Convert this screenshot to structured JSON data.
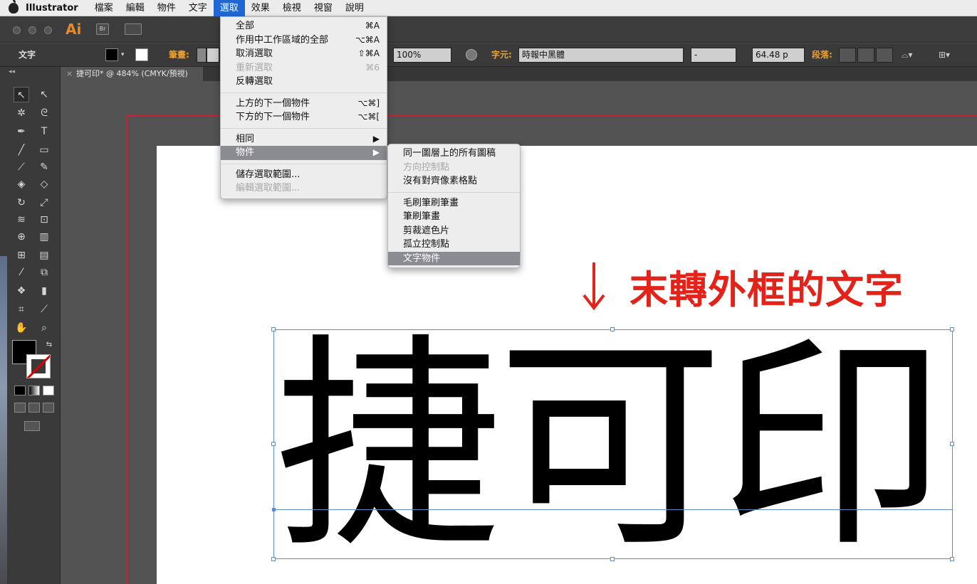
{
  "menubar": {
    "app_name": "Illustrator",
    "items": [
      "檔案",
      "編輯",
      "物件",
      "文字",
      "選取",
      "效果",
      "檢視",
      "視窗",
      "說明"
    ],
    "active_item": "選取"
  },
  "appbar": {
    "logo": "Ai",
    "bridge": "Br"
  },
  "control_bar": {
    "mode_label": "文字",
    "stroke_label": "筆畫:",
    "opacity": "100%",
    "font_label": "字元:",
    "font_name": "時報中黑體",
    "font_style": "-",
    "font_size": "64.48 p",
    "paragraph_label": "段落:"
  },
  "document": {
    "tab_title": "捷可印* @ 484% (CMYK/預視)",
    "close_glyph": "×"
  },
  "select_menu": {
    "items": [
      {
        "label": "全部",
        "shortcut": "⌘A",
        "disabled": false
      },
      {
        "label": "作用中工作區域的全部",
        "shortcut": "⌥⌘A",
        "disabled": false
      },
      {
        "label": "取消選取",
        "shortcut": "⇧⌘A",
        "disabled": false
      },
      {
        "label": "重新選取",
        "shortcut": "⌘6",
        "disabled": true
      },
      {
        "label": "反轉選取",
        "shortcut": "",
        "disabled": false
      },
      {
        "separator": true
      },
      {
        "label": "上方的下一個物件",
        "shortcut": "⌥⌘]",
        "disabled": false
      },
      {
        "label": "下方的下一個物件",
        "shortcut": "⌥⌘[",
        "disabled": false
      },
      {
        "separator": true
      },
      {
        "label": "相同",
        "shortcut": "▶",
        "disabled": false
      },
      {
        "label": "物件",
        "shortcut": "▶",
        "disabled": false,
        "highlighted": true
      },
      {
        "separator": true
      },
      {
        "label": "儲存選取範圍...",
        "shortcut": "",
        "disabled": false
      },
      {
        "label": "編輯選取範圍...",
        "shortcut": "",
        "disabled": true
      }
    ]
  },
  "object_submenu": {
    "items": [
      {
        "label": "同一圖層上的所有圖稿",
        "disabled": false
      },
      {
        "label": "方向控制點",
        "disabled": true
      },
      {
        "label": "沒有對齊像素格點",
        "disabled": false
      },
      {
        "separator": true
      },
      {
        "label": "毛刷筆刷筆畫",
        "disabled": false
      },
      {
        "label": "筆刷筆畫",
        "disabled": false
      },
      {
        "label": "剪裁遮色片",
        "disabled": false
      },
      {
        "label": "孤立控制點",
        "disabled": false
      },
      {
        "label": "文字物件",
        "disabled": false,
        "highlighted": true
      }
    ]
  },
  "canvas": {
    "annotation": "末轉外框的文字",
    "artwork_text": "捷可印"
  },
  "colors": {
    "menu_highlight": "#8b8b92",
    "active_menu": "#1f68d4",
    "annotation": "#e32219",
    "selection": "#5d8ccf",
    "bleed": "#cc2233"
  }
}
